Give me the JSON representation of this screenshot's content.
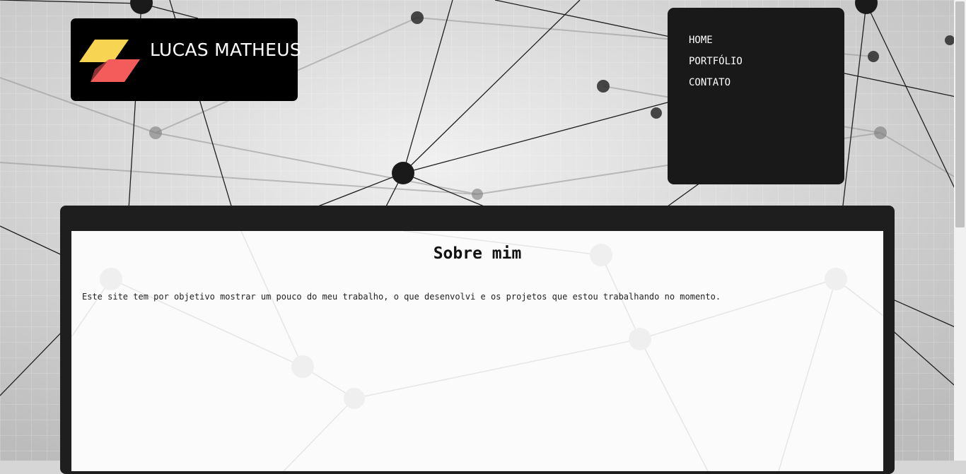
{
  "header": {
    "logo_text": "LUCAS MATHEUS",
    "logo_colors": {
      "top": "#f7d451",
      "bottom": "#f45c5c"
    }
  },
  "nav": {
    "items": [
      {
        "label": "HOME"
      },
      {
        "label": "PORTFÓLIO"
      },
      {
        "label": "CONTATO"
      }
    ]
  },
  "main": {
    "title": "Sobre mim",
    "text": "Este site tem por objetivo mostrar um pouco do meu trabalho, o que desenvolvi e os projetos que estou trabalhando no momento."
  },
  "theme": {
    "background": "#d6d6d6",
    "frame": "#1e1e1e",
    "panel": "#fbfbfb",
    "nav_bg": "#191919"
  }
}
